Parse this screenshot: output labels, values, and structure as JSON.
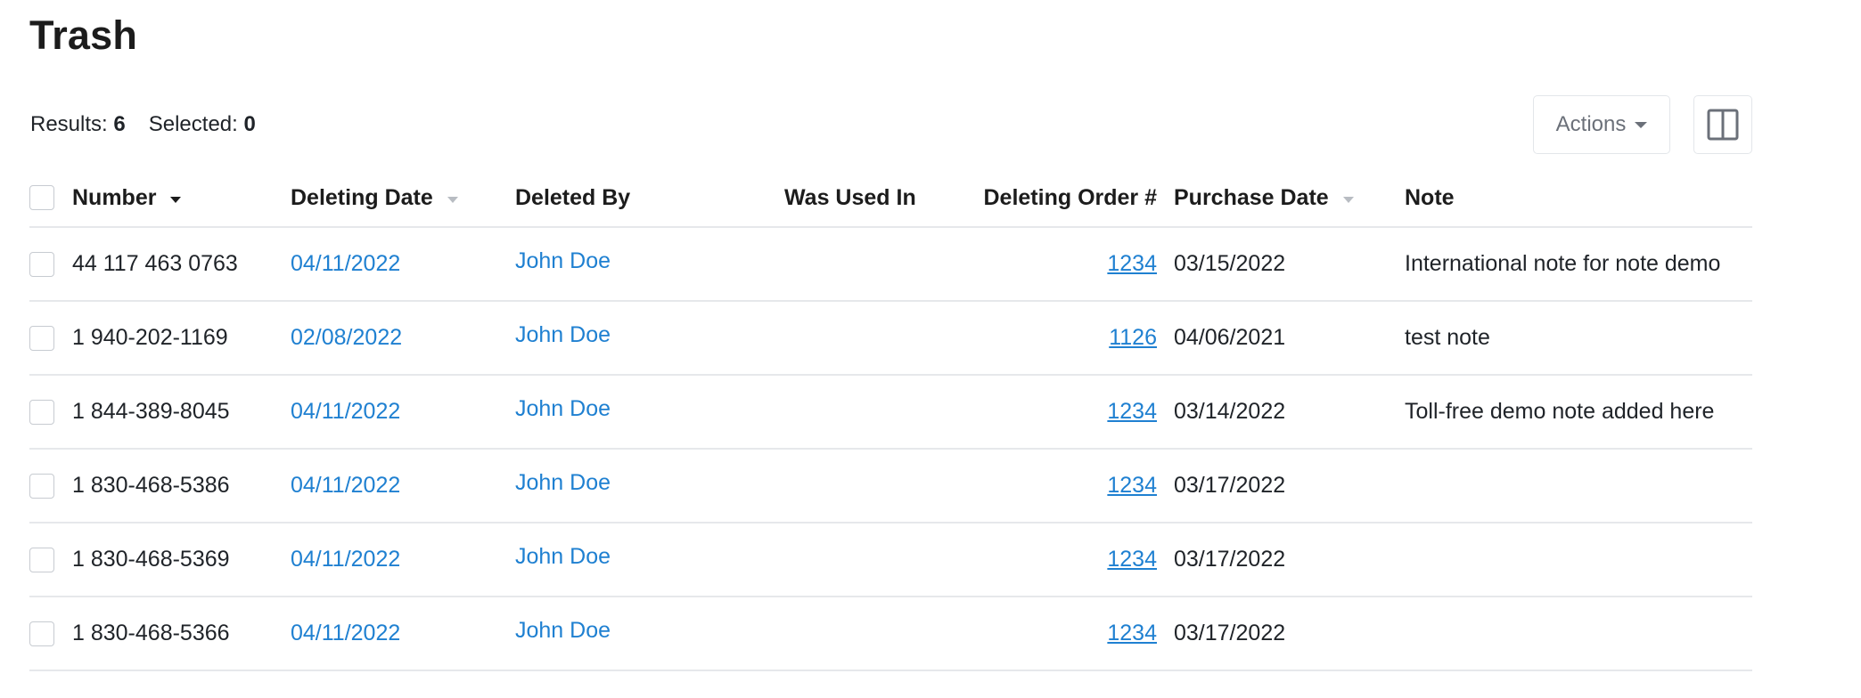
{
  "page": {
    "title": "Trash"
  },
  "summary": {
    "results_label": "Results:",
    "results_count": "6",
    "selected_label": "Selected:",
    "selected_count": "0"
  },
  "toolbar": {
    "actions_label": "Actions",
    "actions_icon": "chevron-down-icon",
    "columns_icon": "columns-layout-icon"
  },
  "table": {
    "headers": {
      "number": "Number",
      "deleting_date": "Deleting Date",
      "deleted_by": "Deleted By",
      "was_used_in": "Was Used In",
      "deleting_order": "Deleting Order #",
      "purchase_date": "Purchase Date",
      "note": "Note"
    },
    "rows": [
      {
        "number": "44 117 463 0763",
        "deleting_date": "04/11/2022",
        "deleted_by": "John Doe",
        "was_used_in": "",
        "deleting_order": "1234",
        "purchase_date": "03/15/2022",
        "note": "International note for note demo"
      },
      {
        "number": "1 940-202-1169",
        "deleting_date": "02/08/2022",
        "deleted_by": "John Doe",
        "was_used_in": "",
        "deleting_order": "1126",
        "purchase_date": "04/06/2021",
        "note": "test note"
      },
      {
        "number": "1 844-389-8045",
        "deleting_date": "04/11/2022",
        "deleted_by": "John Doe",
        "was_used_in": "",
        "deleting_order": "1234",
        "purchase_date": "03/14/2022",
        "note": "Toll-free demo note added here"
      },
      {
        "number": "1 830-468-5386",
        "deleting_date": "04/11/2022",
        "deleted_by": "John Doe",
        "was_used_in": "",
        "deleting_order": "1234",
        "purchase_date": "03/17/2022",
        "note": ""
      },
      {
        "number": "1 830-468-5369",
        "deleting_date": "04/11/2022",
        "deleted_by": "John Doe",
        "was_used_in": "",
        "deleting_order": "1234",
        "purchase_date": "03/17/2022",
        "note": ""
      },
      {
        "number": "1 830-468-5366",
        "deleting_date": "04/11/2022",
        "deleted_by": "John Doe",
        "was_used_in": "",
        "deleting_order": "1234",
        "purchase_date": "03/17/2022",
        "note": ""
      }
    ]
  },
  "colors": {
    "link": "#1f80d1",
    "divider": "#e6e8eb",
    "text": "#1f2328"
  }
}
